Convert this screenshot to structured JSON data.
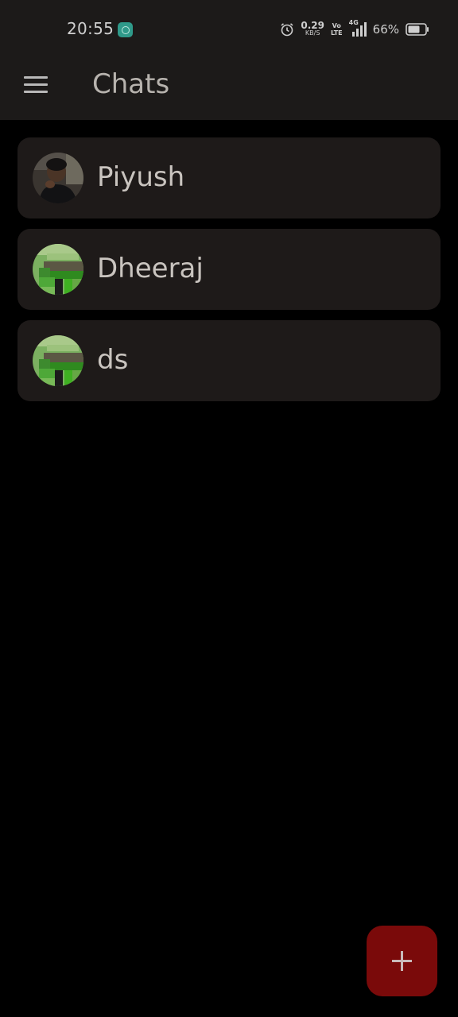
{
  "status_bar": {
    "time": "20:55",
    "net_speed_value": "0.29",
    "net_speed_unit": "KB/S",
    "volte_top": "Vo",
    "volte_bottom": "LTE",
    "network_type": "4G",
    "battery_percent": "66%",
    "icons": [
      "chat-notification-icon",
      "alarm-icon",
      "signal-icon",
      "battery-icon"
    ]
  },
  "app_bar": {
    "title": "Chats",
    "menu_icon": "hamburger-menu-icon"
  },
  "chats": [
    {
      "name": "Piyush",
      "avatar": "photo-avatar"
    },
    {
      "name": "Dheeraj",
      "avatar": "pixel-avatar"
    },
    {
      "name": "ds",
      "avatar": "pixel-avatar"
    }
  ],
  "fab": {
    "icon": "plus-icon",
    "color": "#7a0a0a"
  },
  "colors": {
    "background": "#000000",
    "bar": "#1c1a19",
    "card": "#1e1a19",
    "accent": "#7a0a0a"
  }
}
